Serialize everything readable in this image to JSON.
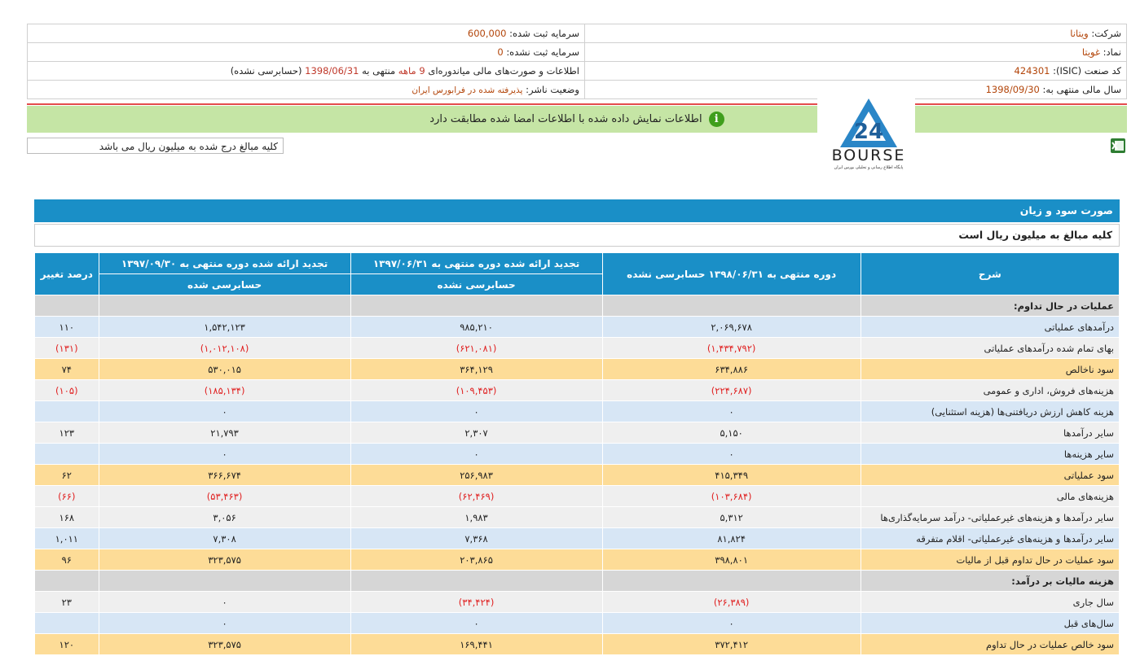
{
  "info": {
    "company_label": "شرکت:",
    "company": "ویتانا",
    "capital_label": "سرمایه ثبت شده:",
    "capital": "600,000",
    "symbol_label": "نماد:",
    "symbol": "غویتا",
    "unregistered_label": "سرمایه ثبت نشده:",
    "unregistered": "0",
    "isic_label": "کد صنعت (ISIC):",
    "isic": "424301",
    "report_prefix": "اطلاعات و صورت‌های مالی میاندوره‌ای",
    "report_period": "9 ماهه",
    "report_mid": "منتهی به",
    "report_date": "1398/06/31",
    "report_suffix": "(حسابرسی نشده)",
    "fiscal_label": "سال مالی منتهی به:",
    "fiscal": "1398/09/30",
    "status_label": "وضعیت ناشر:",
    "status": "پذیرفته شده در فرابورس ایران"
  },
  "banner": {
    "icon": "i",
    "text": "اطلاعات نمایش داده شده با اطلاعات امضا شده مطابقت دارد"
  },
  "logo": {
    "text": "BOURSE",
    "number": "24",
    "tagline": "پایگاه اطلاع رسانی و تحلیلی بورس ایران"
  },
  "unit_note": "کلیه مبالغ درج شده به میلیون ریال می باشد",
  "section": {
    "title": "صورت سود و زیان",
    "unit": "کلیه مبالغ به میلیون ریال است"
  },
  "headers": {
    "desc": "شرح",
    "c1": "دوره منتهی به ۱۳۹۸/۰۶/۳۱ حسابرسی نشده",
    "c2_top": "تجدید ارائه شده دوره منتهی به ۱۳۹۷/۰۶/۳۱",
    "c2_sub": "حسابرسی نشده",
    "c3_top": "تجدید ارائه شده دوره منتهی به ۱۳۹۷/۰۹/۳۰",
    "c3_sub": "حسابرسی شده",
    "c4": "درصد تغییر"
  },
  "rows": [
    {
      "style": "gray",
      "d": "عملیات در حال تداوم:",
      "v1": "",
      "v2": "",
      "v3": "",
      "p": ""
    },
    {
      "style": "blue",
      "d": "درآمدهای عملیاتی",
      "v1": "۲,۰۶۹,۶۷۸",
      "v2": "۹۸۵,۲۱۰",
      "v3": "۱,۵۴۲,۱۲۳",
      "p": "۱۱۰"
    },
    {
      "style": "lgray",
      "d": "بهای تمام شده درآمدهای عملیاتی",
      "v1": "(۱,۴۳۴,۷۹۲)",
      "v2": "(۶۲۱,۰۸۱)",
      "v3": "(۱,۰۱۲,۱۰۸)",
      "p": "(۱۳۱)",
      "neg": true
    },
    {
      "style": "orange",
      "d": "سود ناخالص",
      "v1": "۶۳۴,۸۸۶",
      "v2": "۳۶۴,۱۲۹",
      "v3": "۵۳۰,۰۱۵",
      "p": "۷۴"
    },
    {
      "style": "lgray",
      "d": "هزینه‌های فروش، اداری و عمومی",
      "v1": "(۲۲۴,۶۸۷)",
      "v2": "(۱۰۹,۴۵۳)",
      "v3": "(۱۸۵,۱۳۴)",
      "p": "(۱۰۵)",
      "neg": true
    },
    {
      "style": "blue",
      "d": "هزینه کاهش ارزش دریافتنی‌ها (هزینه استثنایی)",
      "v1": "۰",
      "v2": "۰",
      "v3": "۰",
      "p": ""
    },
    {
      "style": "lgray",
      "d": "سایر درآمدها",
      "v1": "۵,۱۵۰",
      "v2": "۲,۳۰۷",
      "v3": "۲۱,۷۹۳",
      "p": "۱۲۳"
    },
    {
      "style": "blue",
      "d": "سایر هزینه‌ها",
      "v1": "۰",
      "v2": "۰",
      "v3": "۰",
      "p": ""
    },
    {
      "style": "orange",
      "d": "سود عملیاتی",
      "v1": "۴۱۵,۳۴۹",
      "v2": "۲۵۶,۹۸۳",
      "v3": "۳۶۶,۶۷۴",
      "p": "۶۲"
    },
    {
      "style": "lgray",
      "d": "هزینه‌های مالی",
      "v1": "(۱۰۳,۶۸۴)",
      "v2": "(۶۲,۴۶۹)",
      "v3": "(۵۳,۴۶۳)",
      "p": "(۶۶)",
      "neg": true
    },
    {
      "style": "lgray",
      "d": "سایر درآمدها و هزینه‌های غیرعملیاتی- درآمد سرمایه‌گذاری‌ها",
      "v1": "۵,۳۱۲",
      "v2": "۱,۹۸۳",
      "v3": "۳,۰۵۶",
      "p": "۱۶۸"
    },
    {
      "style": "blue",
      "d": "سایر درآمدها و هزینه‌های غیرعملیاتی- اقلام متفرقه",
      "v1": "۸۱,۸۲۴",
      "v2": "۷,۳۶۸",
      "v3": "۷,۳۰۸",
      "p": "۱,۰۱۱"
    },
    {
      "style": "orange",
      "d": "سود عملیات در حال تداوم قبل از مالیات",
      "v1": "۳۹۸,۸۰۱",
      "v2": "۲۰۳,۸۶۵",
      "v3": "۳۲۳,۵۷۵",
      "p": "۹۶"
    },
    {
      "style": "gray",
      "d": "هزینه مالیات بر درآمد:",
      "v1": "",
      "v2": "",
      "v3": "",
      "p": ""
    },
    {
      "style": "lgray",
      "d": "سال جاری",
      "v1": "(۲۶,۳۸۹)",
      "v2": "(۳۴,۴۲۴)",
      "v3": "۰",
      "p": "۲۳",
      "neg": true,
      "v3pos": true,
      "ppos": true
    },
    {
      "style": "blue",
      "d": "سال‌های قبل",
      "v1": "۰",
      "v2": "۰",
      "v3": "۰",
      "p": ""
    },
    {
      "style": "orange",
      "d": "سود خالص عملیات در حال تداوم",
      "v1": "۳۷۲,۴۱۲",
      "v2": "۱۶۹,۴۴۱",
      "v3": "۳۲۳,۵۷۵",
      "p": "۱۲۰"
    }
  ]
}
